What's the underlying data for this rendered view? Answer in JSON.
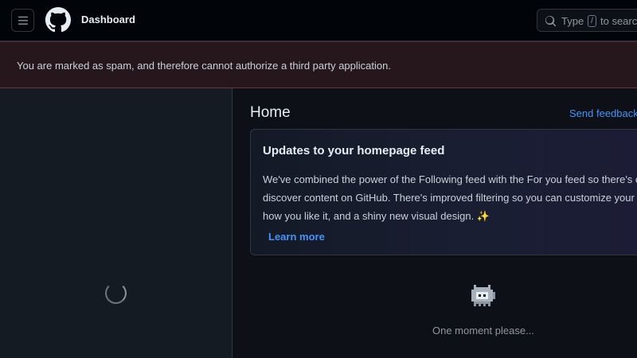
{
  "header": {
    "page_context": "Dashboard",
    "search": {
      "prefix": "Type",
      "key": "/",
      "suffix": "to search"
    }
  },
  "flash": {
    "message": "You are marked as spam, and therefore cannot authorize a third party application."
  },
  "main": {
    "title": "Home",
    "feedback_label": "Send feedback",
    "card": {
      "title": "Updates to your homepage feed",
      "line1": "We've combined the power of the Following feed with the For you feed so there's one place to",
      "line2": "discover content on GitHub. There's improved filtering so you can customize your feed exactly",
      "line3": "how you like it, and a shiny new visual design.",
      "sparkle": "✨",
      "learn_more": "Learn more"
    },
    "loading_text": "One moment please..."
  },
  "icons": {
    "menu": "hamburger-icon",
    "logo": "github-logo-icon",
    "search": "search-icon",
    "loading": "spinner-icon",
    "mascot": "ghost-cat-mascot-icon"
  },
  "colors": {
    "background": "#0d1117",
    "header": "#010409",
    "link": "#4493f8",
    "flash_bg": "#25171c"
  }
}
